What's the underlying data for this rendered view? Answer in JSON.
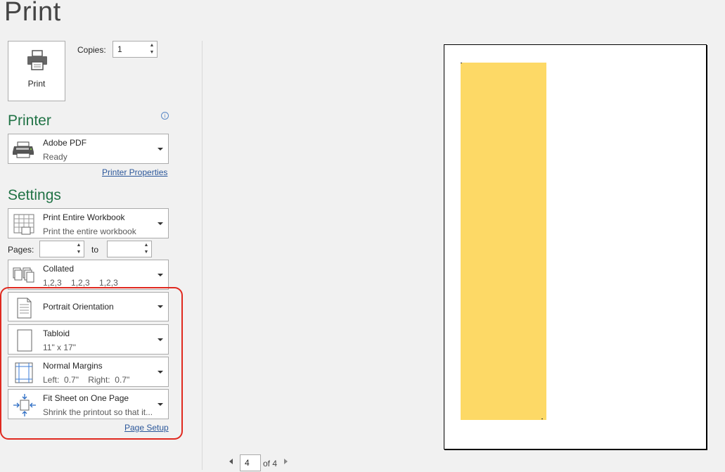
{
  "title": "Print",
  "print_button": {
    "label": "Print",
    "icon": "printer-icon"
  },
  "copies": {
    "label": "Copies:",
    "value": "1"
  },
  "printer": {
    "section_title": "Printer",
    "info_icon": "i",
    "name": "Adobe PDF",
    "status": "Ready",
    "properties_link": "Printer Properties"
  },
  "settings": {
    "section_title": "Settings",
    "what": {
      "title": "Print Entire Workbook",
      "sub": "Print the entire workbook"
    },
    "pages": {
      "label": "Pages:",
      "from": "",
      "to_label": "to",
      "to": ""
    },
    "collation": {
      "title": "Collated",
      "sub": "1,2,3    1,2,3    1,2,3"
    },
    "orientation": {
      "title": "Portrait Orientation"
    },
    "paper": {
      "title": "Tabloid",
      "sub": "11\" x 17\""
    },
    "margins": {
      "title": "Normal Margins",
      "sub": "Left:  0.7\"    Right:  0.7\""
    },
    "scaling": {
      "title": "Fit Sheet on One Page",
      "sub": "Shrink the printout so that it..."
    },
    "page_setup_link": "Page Setup"
  },
  "preview": {
    "current_page": "4",
    "of_label": "of 4"
  },
  "colors": {
    "accent": "#217346",
    "highlight": "#e0291f",
    "fill": "#fdd966",
    "link": "#2b579a"
  }
}
